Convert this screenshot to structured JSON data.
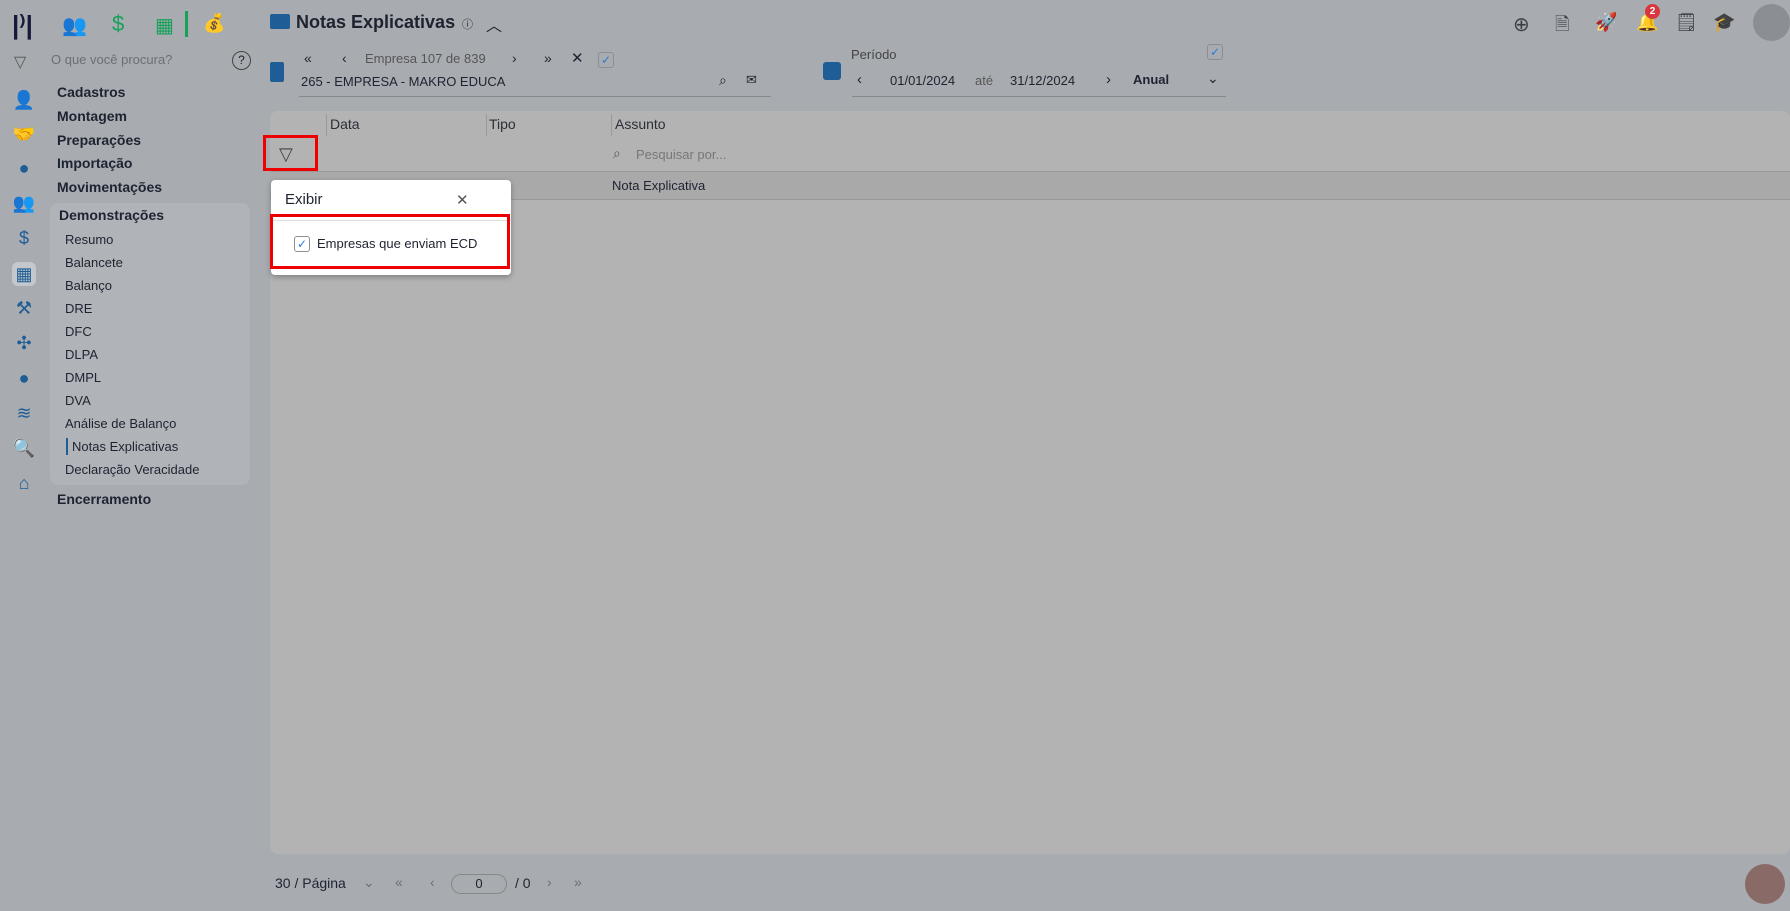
{
  "app": {
    "title": "Notas Explicativas",
    "search_placeholder": "O que você procura?",
    "notification_count": "2"
  },
  "sidebar": {
    "menu": [
      "Cadastros",
      "Montagem",
      "Preparações",
      "Importação",
      "Movimentações"
    ],
    "section": "Demonstrações",
    "sub_items": [
      "Resumo",
      "Balancete",
      "Balanço",
      "DRE",
      "DFC",
      "DLPA",
      "DMPL",
      "DVA",
      "Análise de Balanço",
      "Notas Explicativas",
      "Declaração Veracidade"
    ],
    "active_sub": "Notas Explicativas",
    "last": "Encerramento"
  },
  "company": {
    "nav": "Empresa 107 de 839",
    "name": "265 - EMPRESA - MAKRO EDUCA"
  },
  "period": {
    "label": "Período",
    "from": "01/01/2024",
    "sep": "até",
    "to": "31/12/2024",
    "mode": "Anual"
  },
  "table": {
    "columns": [
      "Data",
      "Tipo",
      "Assunto"
    ],
    "search_placeholder": "Pesquisar por...",
    "rows": [
      {
        "assunto": "Nota Explicativa"
      }
    ]
  },
  "popup": {
    "title": "Exibir",
    "option": "Empresas que enviam ECD",
    "checked": true
  },
  "pagination": {
    "per_page": "30 / Página",
    "page": "0",
    "total": "/ 0"
  },
  "colors": {
    "accent": "#1f5d96",
    "highlight": "#ee0000",
    "badge": "#d9363e"
  }
}
